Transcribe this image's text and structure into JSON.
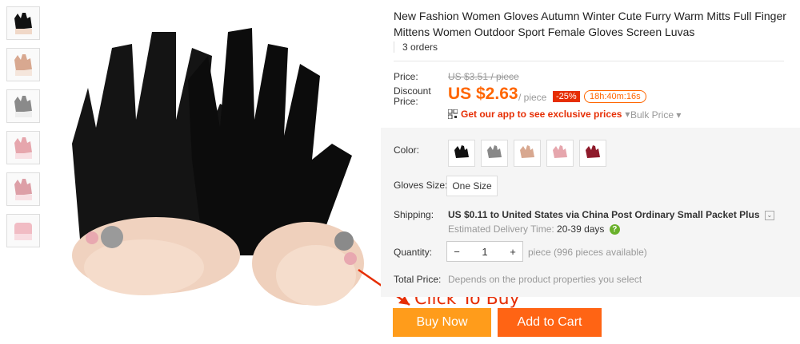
{
  "thumbnails": [
    {
      "name": "black",
      "color": "#111111"
    },
    {
      "name": "pink-beige",
      "color": "#d8a890"
    },
    {
      "name": "gray",
      "color": "#8a8a8a"
    },
    {
      "name": "pink",
      "color": "#e6a6ad"
    },
    {
      "name": "pink-2",
      "color": "#dd9fa7"
    },
    {
      "name": "pink-cuff",
      "color": "#f1bcc4"
    }
  ],
  "product": {
    "title": "New Fashion Women Gloves Autumn Winter Cute Furry Warm Mitts Full Finger Mittens Women Outdoor Sport Female Gloves Screen Luvas",
    "orders": "3 orders"
  },
  "price": {
    "label": "Price:",
    "original": "US $3.51 / piece",
    "discount_label": "Discount Price:",
    "value": "US $2.63",
    "unit": "/ piece",
    "discount_badge": "-25%",
    "timer": "18h:40m:16s",
    "app_text": "Get our app to see exclusive prices",
    "bulk": "Bulk Price"
  },
  "color": {
    "label": "Color:",
    "swatches": [
      "#111111",
      "#888888",
      "#d8a890",
      "#e6a6ad",
      "#8e1a2a"
    ]
  },
  "size": {
    "label": "Gloves Size:",
    "value": "One Size"
  },
  "shipping": {
    "label": "Shipping:",
    "price": "US $0.11",
    "to": "to",
    "destination": "United States via China Post Ordinary Small Packet Plus",
    "est_label": "Estimated Delivery Time:",
    "est_days": "20-39 days"
  },
  "quantity": {
    "label": "Quantity:",
    "value": "1",
    "available": "piece (996 pieces available)"
  },
  "total": {
    "label": "Total Price:",
    "value": "Depends on the product properties you select"
  },
  "annotation": "Click To Buy",
  "buttons": {
    "buy": "Buy Now",
    "cart": "Add to Cart"
  }
}
